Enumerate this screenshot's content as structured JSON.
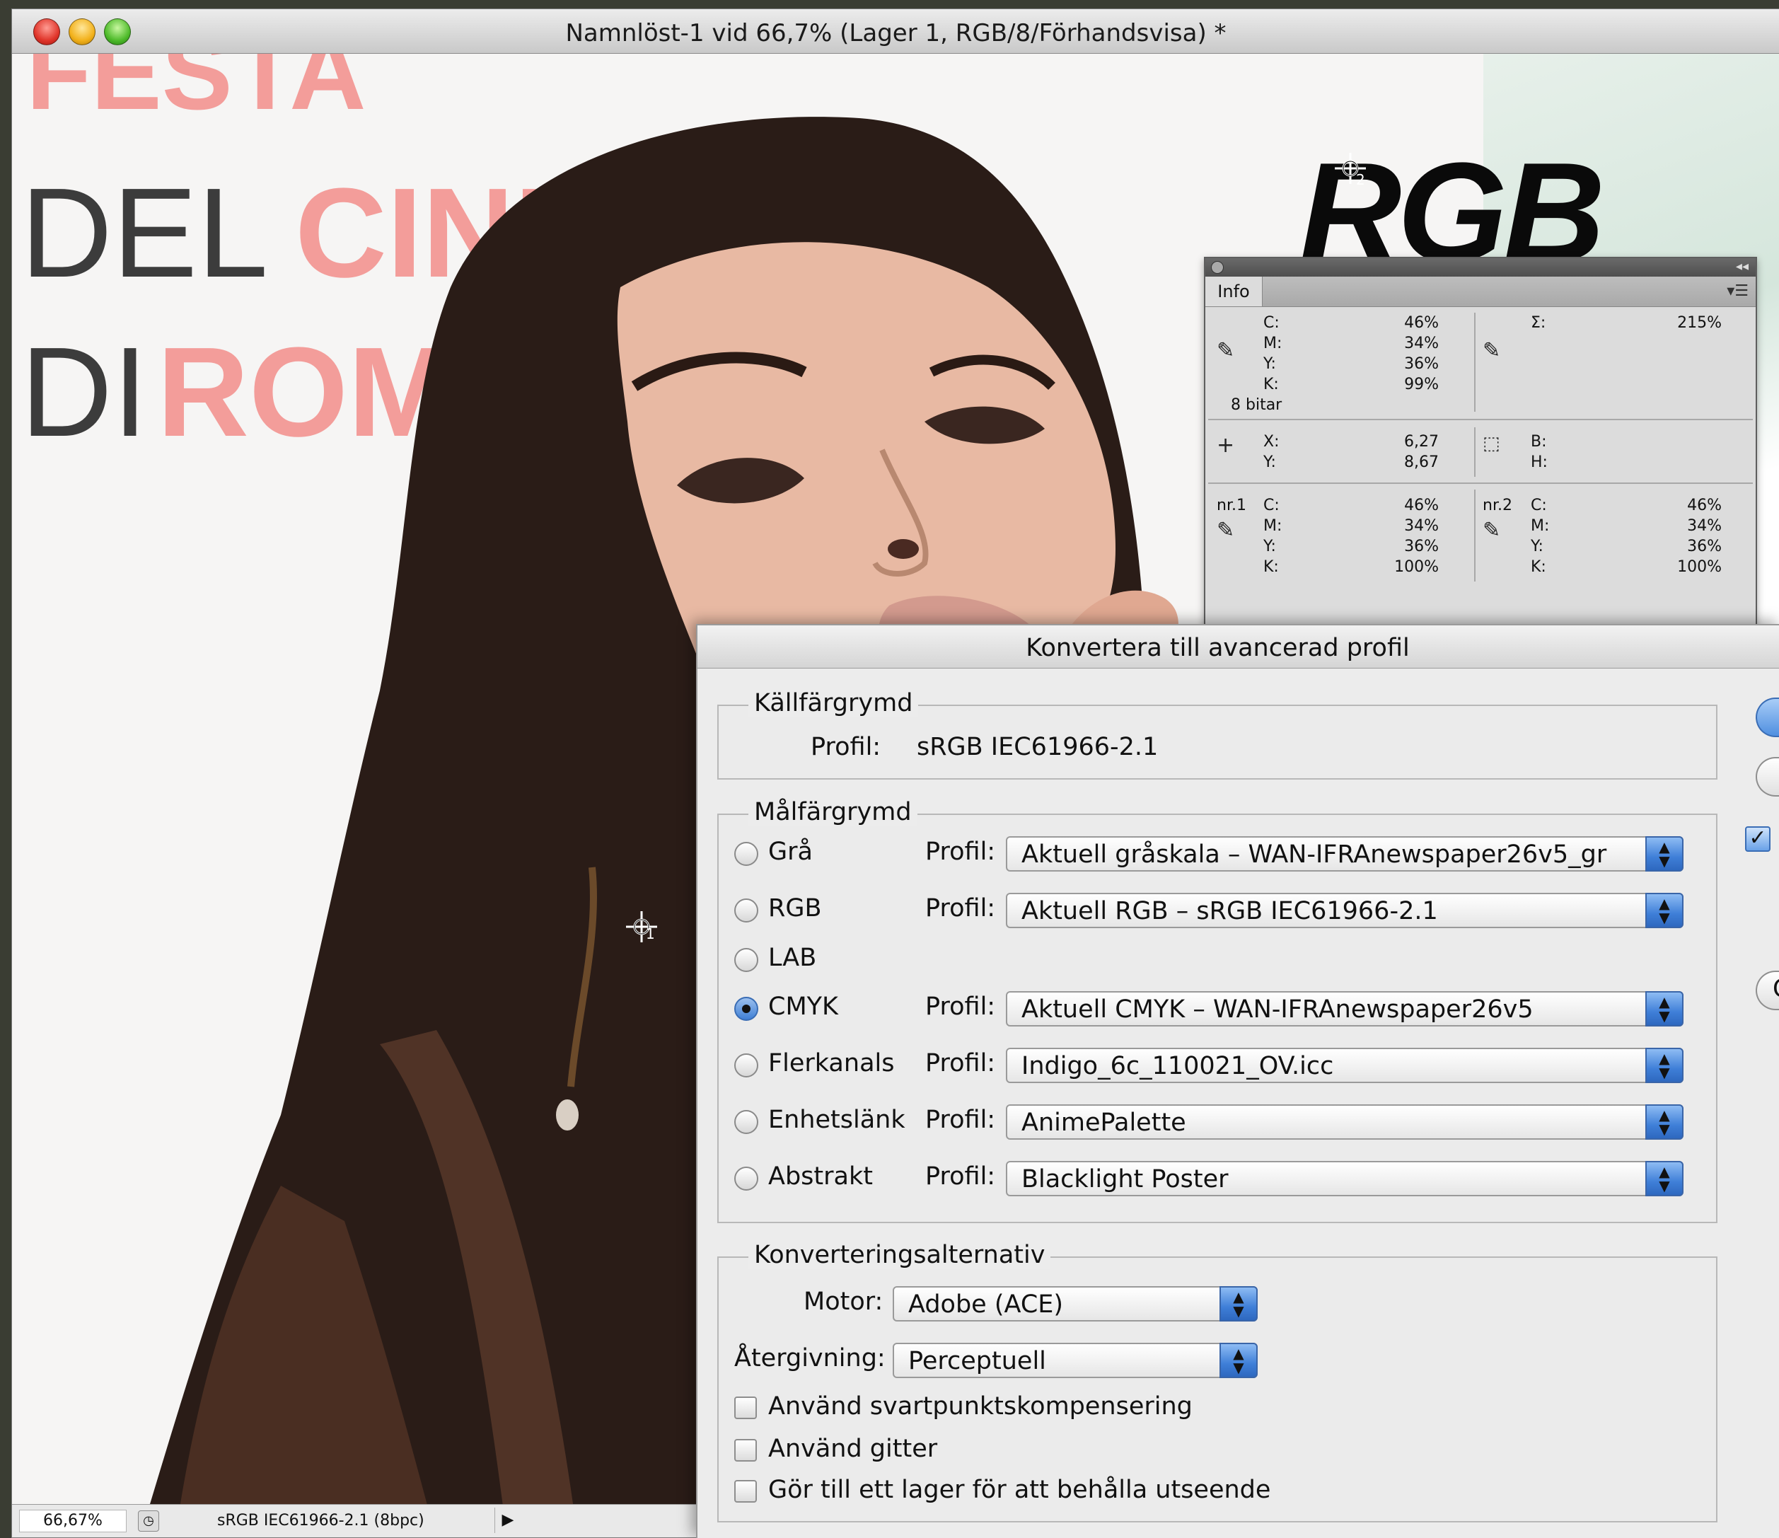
{
  "window": {
    "title": "Namnlöst-1 vid 66,7% (Lager 1, RGB/8/Förhandsvisa) *"
  },
  "canvas": {
    "festa": "FESTA",
    "del": "DEL",
    "cine": "CINE",
    "di": "DI",
    "roma": "ROMA",
    "rgb": "RGB",
    "sampler1": "1",
    "sampler2": "2"
  },
  "statusbar": {
    "zoom": "66,67%",
    "profile": "sRGB IEC61966-2.1 (8bpc)",
    "arrow": "▶"
  },
  "info": {
    "tab": "Info",
    "sample_main": {
      "labels": [
        "C:",
        "M:",
        "Y:",
        "K:"
      ],
      "values": [
        "46%",
        "34%",
        "36%",
        "99%"
      ],
      "bits": "8 bitar"
    },
    "total": {
      "label": "Σ:",
      "value": "215%"
    },
    "position": {
      "labels": [
        "X:",
        "Y:"
      ],
      "values": [
        "6,27",
        "8,67"
      ]
    },
    "size": {
      "labels": [
        "B:",
        "H:"
      ]
    },
    "sampler1": {
      "name": "nr.1",
      "labels": [
        "C:",
        "M:",
        "Y:",
        "K:"
      ],
      "values": [
        "46%",
        "34%",
        "36%",
        "100%"
      ]
    },
    "sampler2": {
      "name": "nr.2",
      "labels": [
        "C:",
        "M:",
        "Y:",
        "K:"
      ],
      "values": [
        "46%",
        "34%",
        "36%",
        "100%"
      ]
    }
  },
  "dialog": {
    "title": "Konvertera till avancerad profil",
    "source": {
      "legend": "Källfärgrymd",
      "profile_label": "Profil:",
      "profile_value": "sRGB IEC61966-2.1"
    },
    "dest": {
      "legend": "Målfärgrymd",
      "profile_label": "Profil:",
      "rows": [
        {
          "label": "Grå",
          "selected": false,
          "profile": "Aktuell gråskala – WAN-IFRAnewspaper26v5_gr"
        },
        {
          "label": "RGB",
          "selected": false,
          "profile": "Aktuell RGB – sRGB IEC61966-2.1"
        },
        {
          "label": "LAB",
          "selected": false,
          "profile": ""
        },
        {
          "label": "CMYK",
          "selected": true,
          "profile": "Aktuell CMYK – WAN-IFRAnewspaper26v5"
        },
        {
          "label": "Flerkanals",
          "selected": false,
          "profile": "Indigo_6c_110021_OV.icc"
        },
        {
          "label": "Enhetslänk",
          "selected": false,
          "profile": "AnimePalette"
        },
        {
          "label": "Abstrakt",
          "selected": false,
          "profile": "Blacklight Poster"
        }
      ]
    },
    "options": {
      "legend": "Konverteringsalternativ",
      "engine_label": "Motor:",
      "engine_value": "Adobe (ACE)",
      "intent_label": "Återgivning:",
      "intent_value": "Perceptuell",
      "checkboxes": [
        {
          "label": "Använd svartpunktskompensering",
          "checked": false
        },
        {
          "label": "Använd gitter",
          "checked": false
        },
        {
          "label": "Gör till ett lager för att behålla utseende",
          "checked": false
        }
      ]
    },
    "side": {
      "preview_check": "✓",
      "partial_c": "C"
    }
  },
  "colors": {
    "festa_pink": "#f39d9a",
    "accent_blue": "#3f7fd8",
    "hair": "#2a1c17"
  }
}
